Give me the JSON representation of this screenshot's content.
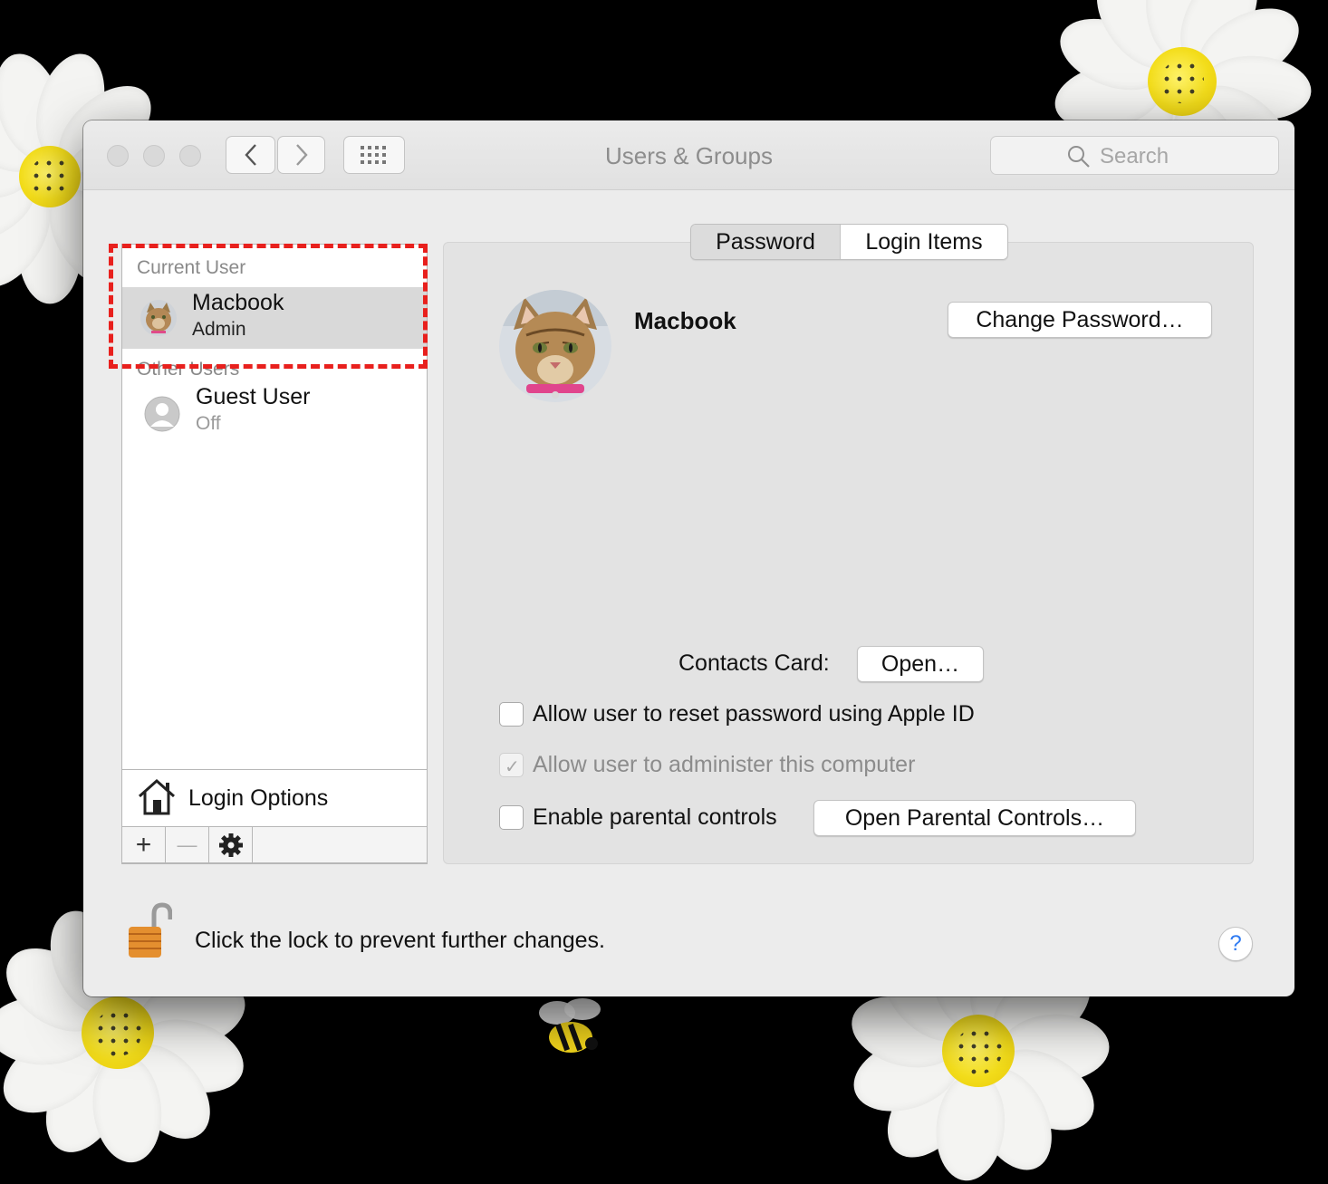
{
  "window": {
    "title": "Users & Groups",
    "search_placeholder": "Search"
  },
  "sidebar": {
    "current_user_label": "Current User",
    "current_user": {
      "name": "Macbook",
      "role": "Admin"
    },
    "other_users_label": "Other Users",
    "other_users": [
      {
        "name": "Guest User",
        "status": "Off"
      }
    ],
    "login_options_label": "Login Options",
    "bottom_buttons": {
      "add": "+",
      "remove": "—"
    }
  },
  "tabs": [
    {
      "label": "Password",
      "selected": true
    },
    {
      "label": "Login Items",
      "selected": false
    }
  ],
  "panel": {
    "user_name": "Macbook",
    "change_password_label": "Change Password…",
    "contacts_card_label": "Contacts Card:",
    "open_label": "Open…",
    "checkboxes": [
      {
        "label": "Allow user to reset password using Apple ID",
        "checked": false,
        "enabled": true
      },
      {
        "label": "Allow user to administer this computer",
        "checked": true,
        "enabled": false
      },
      {
        "label": "Enable parental controls",
        "checked": false,
        "enabled": true
      }
    ],
    "open_parental_controls_label": "Open Parental Controls…"
  },
  "footer": {
    "lock_text": "Click the lock to prevent further changes.",
    "help_label": "?"
  },
  "icons": [
    "chevron-left-icon",
    "chevron-right-icon",
    "grid-icon",
    "search-icon",
    "house-icon",
    "gear-icon",
    "lock-icon",
    "help-icon",
    "guest-avatar-icon"
  ],
  "colors": {
    "highlight": "#e8201d",
    "help_accent": "#2f7bf2"
  }
}
